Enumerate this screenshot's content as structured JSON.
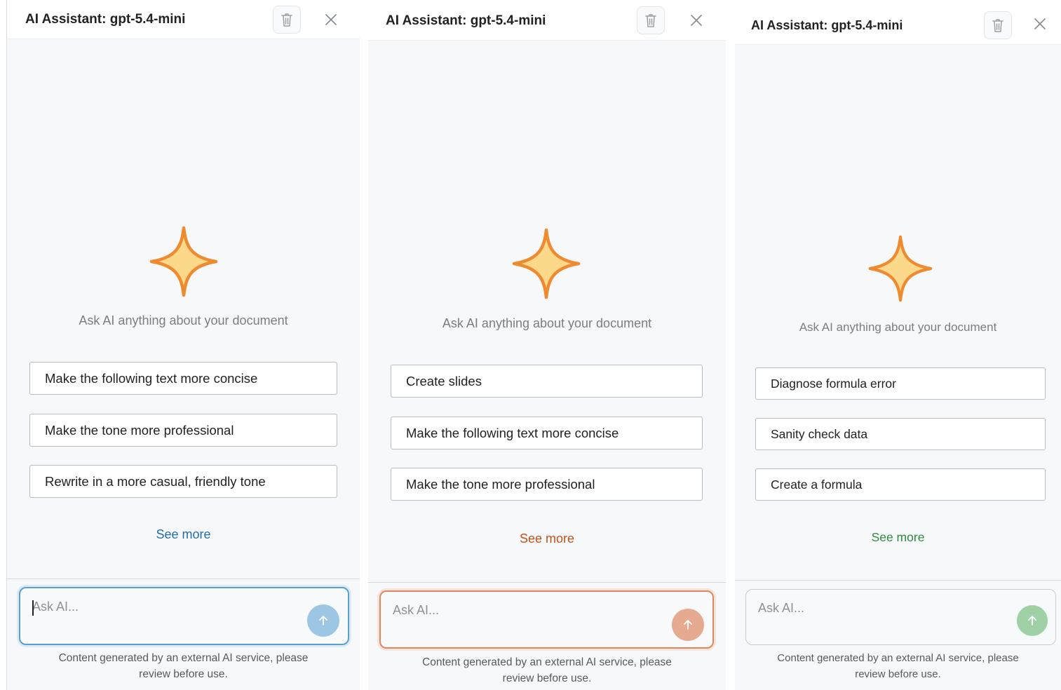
{
  "panels": [
    {
      "title": "AI Assistant: gpt-5.4-mini",
      "tagline": "Ask AI anything about your document",
      "suggestions": [
        "Make the following text more concise",
        "Make the tone more professional",
        "Rewrite in a more casual, friendly tone"
      ],
      "see_more": "See more",
      "input_placeholder": "Ask AI...",
      "disclaimer_line1": "Content generated by an external AI service, please",
      "disclaimer_line2": "review before use.",
      "accent_color": "#1f6fa8",
      "send_button_color": "#9cc6e4"
    },
    {
      "title": "AI Assistant: gpt-5.4-mini",
      "tagline": "Ask AI anything about your document",
      "suggestions": [
        "Create slides",
        "Make the following text more concise",
        "Make the tone more professional"
      ],
      "see_more": "See more",
      "input_placeholder": "Ask AI...",
      "disclaimer_line1": "Content generated by an external AI service, please",
      "disclaimer_line2": "review before use.",
      "accent_color": "#c0531b",
      "send_button_color": "#e5aa90"
    },
    {
      "title": "AI Assistant: gpt-5.4-mini",
      "tagline": "Ask AI anything about your document",
      "suggestions": [
        "Diagnose formula error",
        "Sanity check data",
        "Create a formula"
      ],
      "see_more": "See more",
      "input_placeholder": "Ask AI...",
      "disclaimer_line1": "Content generated by an external AI service, please",
      "disclaimer_line2": "review before use.",
      "accent_color": "#2f8a3e",
      "send_button_color": "#9fd0a6"
    }
  ],
  "icons": {
    "trash": "trash-icon",
    "close": "close-icon",
    "sparkle": "sparkle-star-icon",
    "send": "arrow-up-icon"
  },
  "star_colors": {
    "fill": "#fcd98a",
    "stroke": "#ee8a2f"
  }
}
